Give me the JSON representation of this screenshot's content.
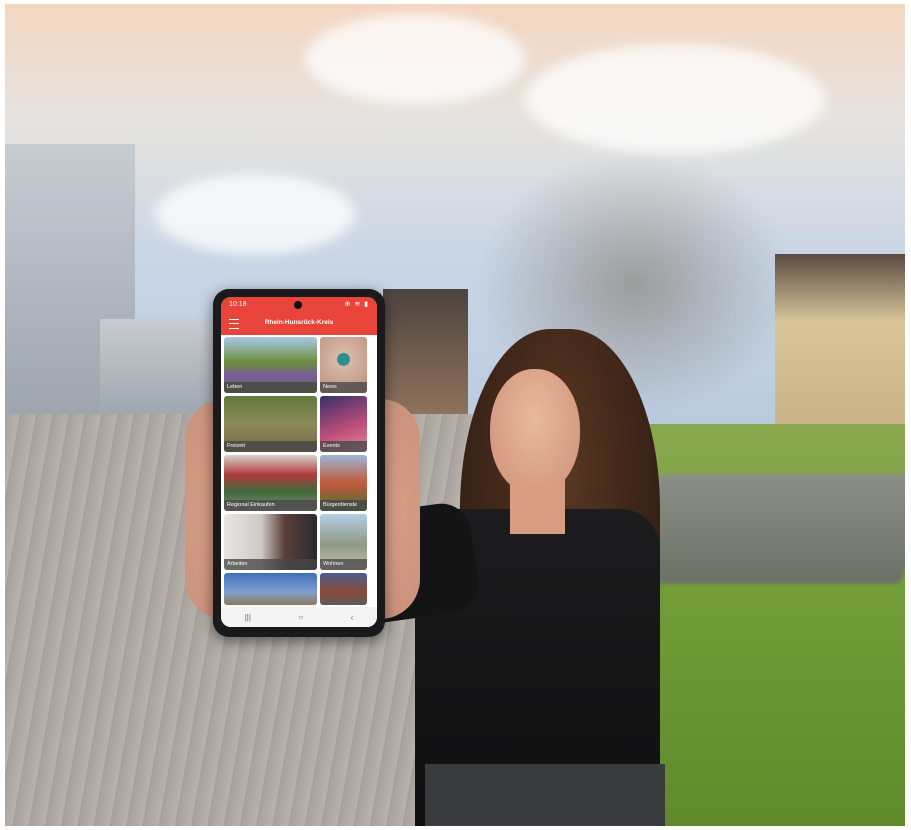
{
  "phone": {
    "status_time": "10:18",
    "status_icons": "⊕ ≋ ▮",
    "app_title": "Rhein-Hunsrück-Kreis",
    "tiles": [
      {
        "label": "Leben"
      },
      {
        "label": "News"
      },
      {
        "label": "Freizeit"
      },
      {
        "label": "Events"
      },
      {
        "label": "Regional Einkaufen"
      },
      {
        "label": "Bürgerdienste"
      },
      {
        "label": "Arbeiten"
      },
      {
        "label": "Wohnen"
      },
      {
        "label": ""
      },
      {
        "label": ""
      }
    ],
    "nav": {
      "recent": "|||",
      "home": "○",
      "back": "‹"
    },
    "colors": {
      "appbar": "#e8443a"
    }
  }
}
